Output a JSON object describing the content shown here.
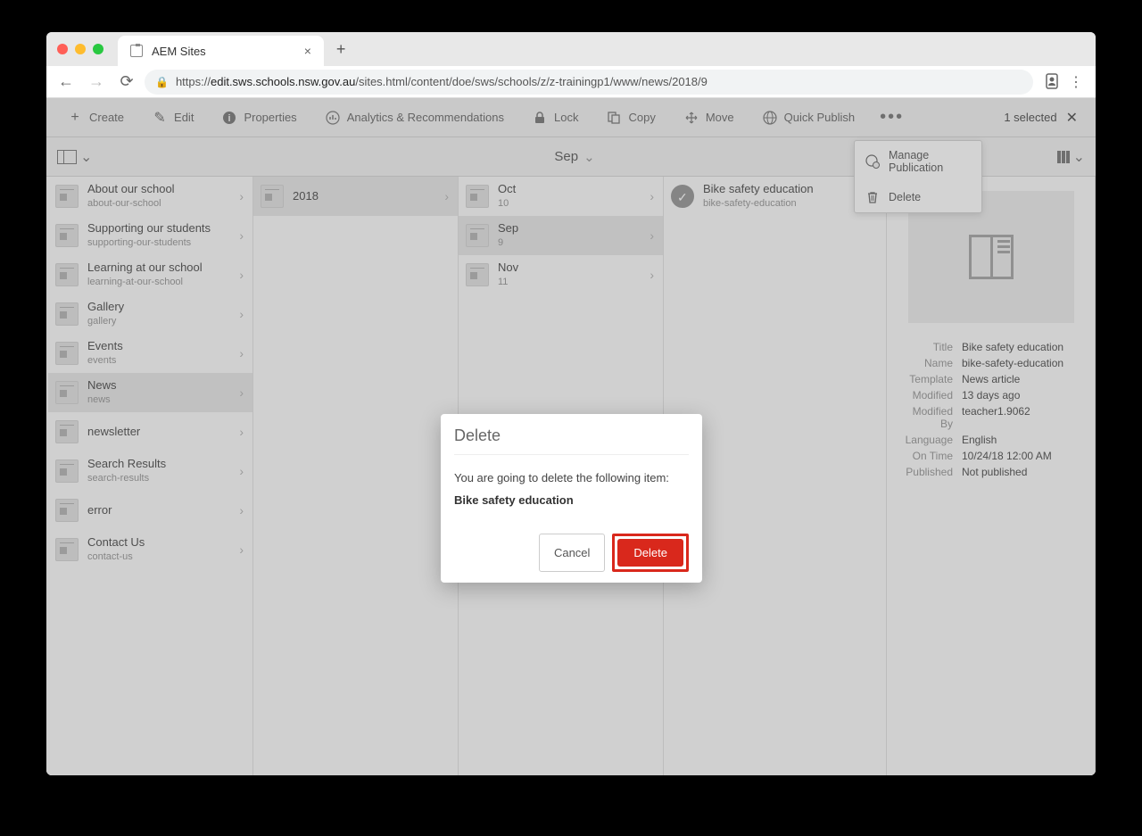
{
  "tab": {
    "title": "AEM Sites"
  },
  "url": {
    "bold": "edit.sws.schools.nsw.gov.au",
    "rest": "/sites.html/content/doe/sws/schools/z/z-trainingp1/www/news/2018/9"
  },
  "toolbar": {
    "create": "Create",
    "edit": "Edit",
    "properties": "Properties",
    "analytics": "Analytics & Recommendations",
    "lock": "Lock",
    "copy": "Copy",
    "move": "Move",
    "quick_publish": "Quick Publish",
    "selection": "1 selected"
  },
  "breadcrumb": "Sep",
  "col1": [
    {
      "title": "About our school",
      "sub": "about-our-school"
    },
    {
      "title": "Supporting our students",
      "sub": "supporting-our-students"
    },
    {
      "title": "Learning at our school",
      "sub": "learning-at-our-school"
    },
    {
      "title": "Gallery",
      "sub": "gallery"
    },
    {
      "title": "Events",
      "sub": "events"
    },
    {
      "title": "News",
      "sub": "news",
      "selected": true
    },
    {
      "title": "newsletter",
      "sub": ""
    },
    {
      "title": "Search Results",
      "sub": "search-results"
    },
    {
      "title": "error",
      "sub": ""
    },
    {
      "title": "Contact Us",
      "sub": "contact-us"
    }
  ],
  "col2": [
    {
      "title": "2018",
      "sub": "",
      "selected": true
    }
  ],
  "col3": [
    {
      "title": "Oct",
      "sub": "10"
    },
    {
      "title": "Sep",
      "sub": "9",
      "selected": true
    },
    {
      "title": "Nov",
      "sub": "11"
    }
  ],
  "col4": [
    {
      "title": "Bike safety education",
      "sub": "bike-safety-education",
      "checked": true
    }
  ],
  "context_menu": {
    "manage": "Manage Publication",
    "delete": "Delete"
  },
  "details": {
    "rows": [
      {
        "label": "Title",
        "value": "Bike safety education"
      },
      {
        "label": "Name",
        "value": "bike-safety-education"
      },
      {
        "label": "Template",
        "value": "News article"
      },
      {
        "label": "Modified",
        "value": "13 days ago"
      },
      {
        "label": "Modified By",
        "value": "teacher1.9062"
      },
      {
        "label": "Language",
        "value": "English"
      },
      {
        "label": "On Time",
        "value": "10/24/18 12:00 AM"
      },
      {
        "label": "Published",
        "value": "Not published"
      }
    ]
  },
  "dialog": {
    "title": "Delete",
    "message": "You are going to delete the following item:",
    "item": "Bike safety education",
    "cancel": "Cancel",
    "confirm": "Delete"
  }
}
